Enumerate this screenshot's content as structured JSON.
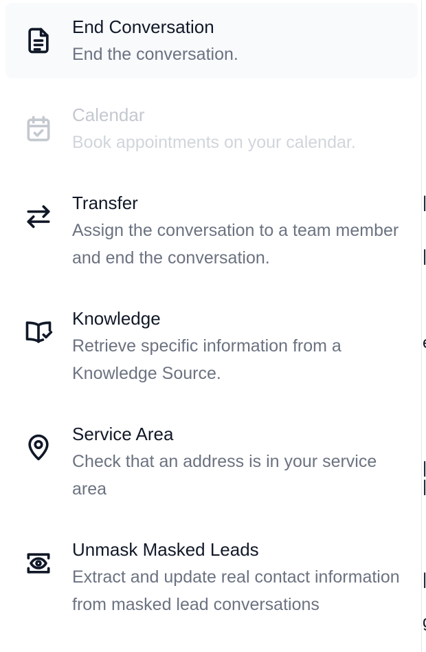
{
  "colors": {
    "title": "#111827",
    "description": "#6b7280",
    "disabled": "#c4c8cf",
    "active_bg": "#f8fafc"
  },
  "menu": {
    "items": [
      {
        "title": "End Conversation",
        "description": "End the conversation.",
        "icon": "document-icon",
        "state": "active"
      },
      {
        "title": "Calendar",
        "description": "Book appointments on your calendar.",
        "icon": "calendar-check-icon",
        "state": "disabled"
      },
      {
        "title": "Transfer",
        "description": "Assign the conversation to a team member and end the conversation.",
        "icon": "arrows-transfer-icon",
        "state": "default"
      },
      {
        "title": "Knowledge",
        "description": "Retrieve specific information from a Knowledge Source.",
        "icon": "book-check-icon",
        "state": "default"
      },
      {
        "title": "Service Area",
        "description": "Check that an address is in your service area",
        "icon": "map-pin-icon",
        "state": "default"
      },
      {
        "title": "Unmask Masked Leads",
        "description": "Extract and update real contact information from masked lead conversations",
        "icon": "eye-scan-icon",
        "state": "default"
      }
    ]
  }
}
